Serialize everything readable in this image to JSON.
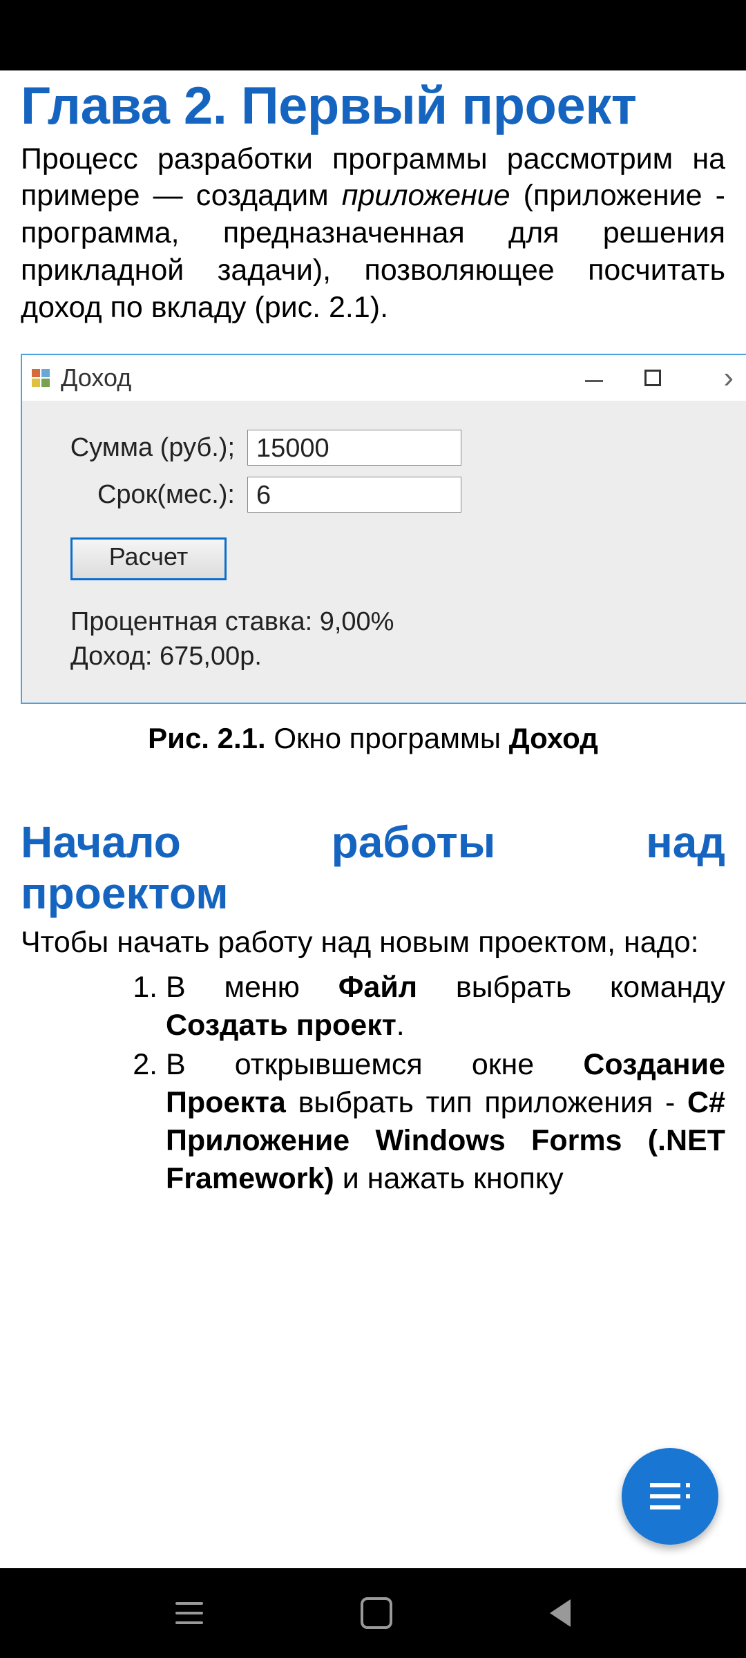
{
  "chapter_title": "Глава 2. Первый проект",
  "intro": {
    "p1_a": "Процесс разработки программы рассмотрим на примере — создадим ",
    "p1_em": "приложение",
    "p1_b": " (приложение - программа, предназначенная для решения прикладной задачи), позволяющее посчитать доход по вкладу (рис. 2.1)."
  },
  "winform": {
    "title": "Доход",
    "fields": {
      "sum_label": "Сумма (руб.);",
      "sum_value": "15000",
      "term_label": "Срок(мес.):",
      "term_value": "6"
    },
    "button": "Расчет",
    "result_rate": "Процентная ставка: 9,00%",
    "result_income": "Доход: 675,00р."
  },
  "caption": {
    "fig": "Рис. 2.1.",
    "text": " Окно программы ",
    "bold": "Доход"
  },
  "section_title_line1": "Начало работы над",
  "section_title_line2": "проектом",
  "section_intro": "Чтобы начать работу над новым проектом, надо:",
  "steps": {
    "s1_a": "В меню ",
    "s1_b1": "Файл",
    "s1_b": " выбрать команду ",
    "s1_b2": "Создать проект",
    "s1_c": ".",
    "s2_a": "В открывшемся окне ",
    "s2_b1": "Создание Проекта",
    "s2_b": " выбрать тип приложения - ",
    "s2_b2": "C# Приложение Windows Forms (.NET Framework)",
    "s2_c": " и нажать кнопку"
  }
}
